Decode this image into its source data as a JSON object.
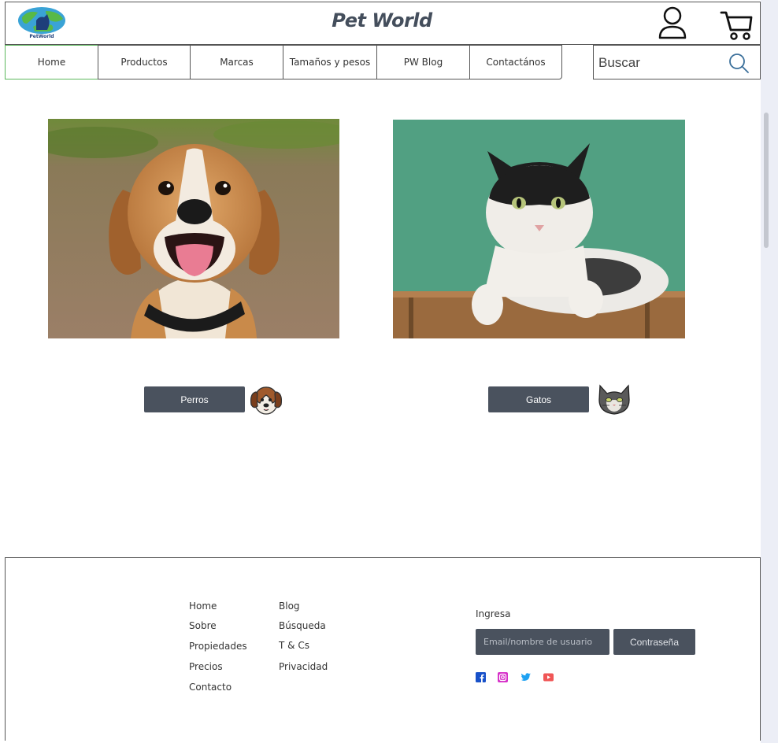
{
  "header": {
    "brand": "Pet World",
    "logo_text": "PetWorld",
    "icons": [
      "user-icon",
      "cart-icon"
    ]
  },
  "nav": {
    "items": [
      {
        "label": "Home",
        "active": true
      },
      {
        "label": "Productos"
      },
      {
        "label": "Marcas"
      },
      {
        "label": "Tamaños y pesos"
      },
      {
        "label": "PW Blog"
      },
      {
        "label": "Contactános"
      }
    ]
  },
  "search": {
    "placeholder": "Buscar",
    "icon": "search-icon"
  },
  "categories": [
    {
      "label": "Perros",
      "photo": "beagle-photo",
      "icon": "dog-face-icon"
    },
    {
      "label": "Gatos",
      "photo": "cat-photo",
      "icon": "cat-face-icon"
    }
  ],
  "footer": {
    "links_col1": [
      "Home",
      "Sobre",
      "Propiedades",
      "Precios",
      "Contacto"
    ],
    "links_col2": [
      "Blog",
      "Búsqueda",
      "T & Cs",
      "Privacidad"
    ],
    "login": {
      "label": "Ingresa",
      "email_placeholder": "Email/nombre de usuario",
      "password_label": "Contraseña"
    },
    "social": [
      "facebook-icon",
      "instagram-icon",
      "twitter-icon",
      "youtube-icon"
    ]
  },
  "colors": {
    "button_bg": "#4a525e",
    "brand_text": "#444e5c",
    "active_nav_border": "#5cb85c",
    "facebook": "#1877f2",
    "instagram": "#d62fc8",
    "twitter": "#1da1f2",
    "youtube": "#f05656"
  }
}
